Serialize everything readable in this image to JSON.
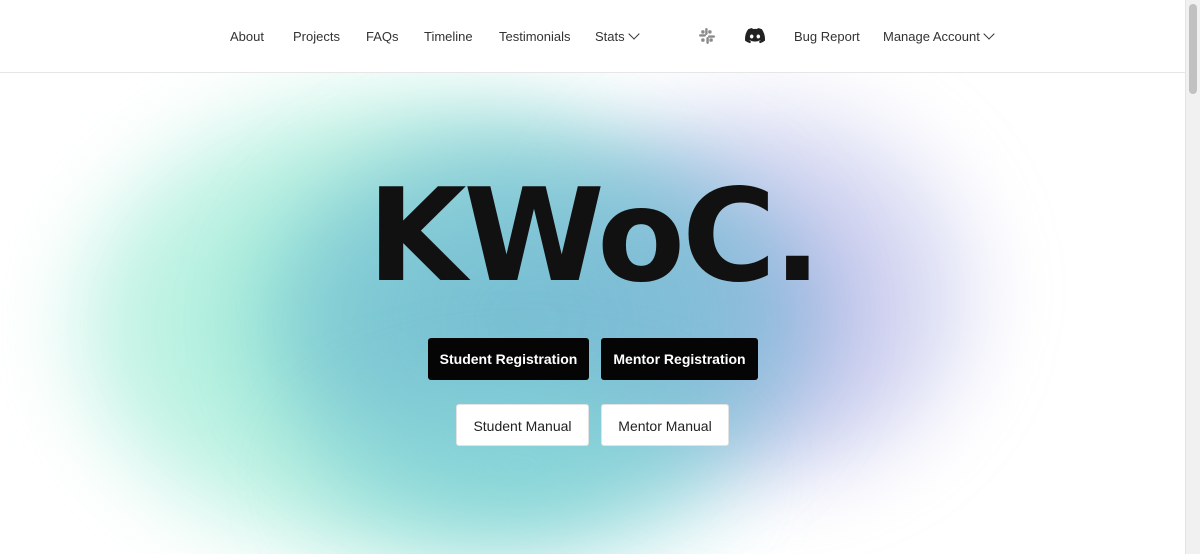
{
  "nav": {
    "links": [
      "About",
      "Projects",
      "FAQs",
      "Timeline",
      "Testimonials"
    ],
    "stats_label": "Stats",
    "bug_report": "Bug Report",
    "manage_account": "Manage Account",
    "icons": [
      "slack-icon",
      "discord-icon"
    ]
  },
  "hero": {
    "title": "KWoC."
  },
  "buttons": {
    "student_registration": "Student Registration",
    "mentor_registration": "Mentor Registration",
    "student_manual": "Student Manual",
    "mentor_manual": "Mentor Manual"
  },
  "colors": {
    "primary_button": "#050505",
    "text": "#111111",
    "blob_green": "#8ee8cd",
    "blob_teal": "#7cbcd4",
    "blob_purple": "#a5a6de"
  }
}
